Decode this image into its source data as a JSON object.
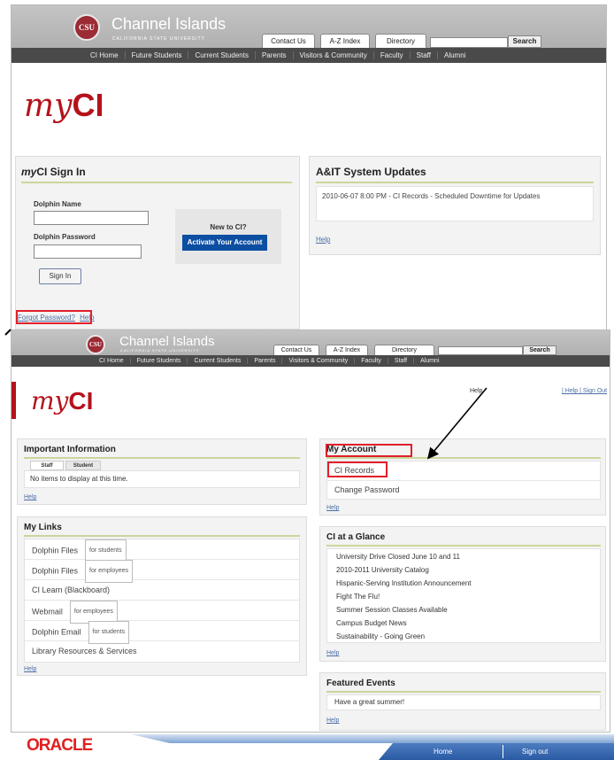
{
  "shot1": {
    "logo": {
      "initials": "CSU",
      "name": "Channel Islands",
      "subtitle": "CALIFORNIA STATE UNIVERSITY"
    },
    "tabs": [
      "Contact Us",
      "A-Z Index",
      "Directory"
    ],
    "search_button": "Search",
    "nav": [
      "CI Home",
      "Future Students",
      "Current Students",
      "Parents",
      "Visitors & Community",
      "Faculty",
      "Staff",
      "Alumni"
    ],
    "brand": {
      "prefix": "my",
      "suffix": "CI"
    },
    "signin": {
      "title_prefix": "my",
      "title_suffix": "CI Sign In",
      "dolphin_name_label": "Dolphin Name",
      "dolphin_password_label": "Dolphin Password",
      "signin_button": "Sign In",
      "new_label": "New to CI?",
      "activate_button": "Activate Your Account",
      "forgot_link": "Forgot Password?",
      "help_link": "Help"
    },
    "updates": {
      "title": "A&IT System Updates",
      "text": "2010-06-07 8:00 PM - CI Records - Scheduled Downtime for Updates",
      "help_link": "Help"
    }
  },
  "shot2": {
    "logo": {
      "initials": "CSU",
      "name": "Channel Islands",
      "subtitle": "CALIFORNIA STATE UNIVERSITY"
    },
    "tabs": [
      "Contact Us",
      "A-Z Index",
      "Directory"
    ],
    "search_button": "Search",
    "nav": [
      "CI Home",
      "Future Students",
      "Current Students",
      "Parents",
      "Visitors & Community",
      "Faculty",
      "Staff",
      "Alumni"
    ],
    "brand": {
      "prefix": "my",
      "suffix": "CI"
    },
    "top_help": "Help",
    "top_links": "| Help | Sign Out",
    "important": {
      "title": "Important Information",
      "tabs": [
        "Staff",
        "Student"
      ],
      "text": "No items to display at this time.",
      "help_link": "Help"
    },
    "links": {
      "title": "My Links",
      "items": [
        {
          "label": "Dolphin Files",
          "tag": "for students"
        },
        {
          "label": "Dolphin Files",
          "tag": "for employees"
        },
        {
          "label": "CI Learn (Blackboard)",
          "tag": ""
        },
        {
          "label": "Webmail",
          "tag": "for employees"
        },
        {
          "label": "Dolphin Email",
          "tag": "for students"
        },
        {
          "label": "Library Resources & Services",
          "tag": ""
        }
      ],
      "help_link": "Help"
    },
    "account": {
      "title": "My Account",
      "items": [
        "CI Records",
        "Change Password"
      ],
      "help_link": "Help"
    },
    "glance": {
      "title": "CI at a Glance",
      "items": [
        "University Drive Closed June 10 and 11",
        "2010-2011 University Catalog",
        "Hispanic-Serving Institution Announcement",
        "Fight The Flu!",
        "Summer Session Classes Available",
        "Campus Budget News",
        "Sustainability - Going Green"
      ],
      "help_link": "Help"
    },
    "featured": {
      "title": "Featured Events",
      "text": "Have a great summer!",
      "help_link": "Help"
    }
  },
  "oracle": {
    "logo": "ORACLE",
    "home": "Home",
    "signout": "Sign out"
  },
  "colors": {
    "brand_red": "#b5121b",
    "highlight_red": "#e0202a",
    "nav_dark": "#4a4a4a",
    "activate_blue": "#0b4ea2"
  }
}
